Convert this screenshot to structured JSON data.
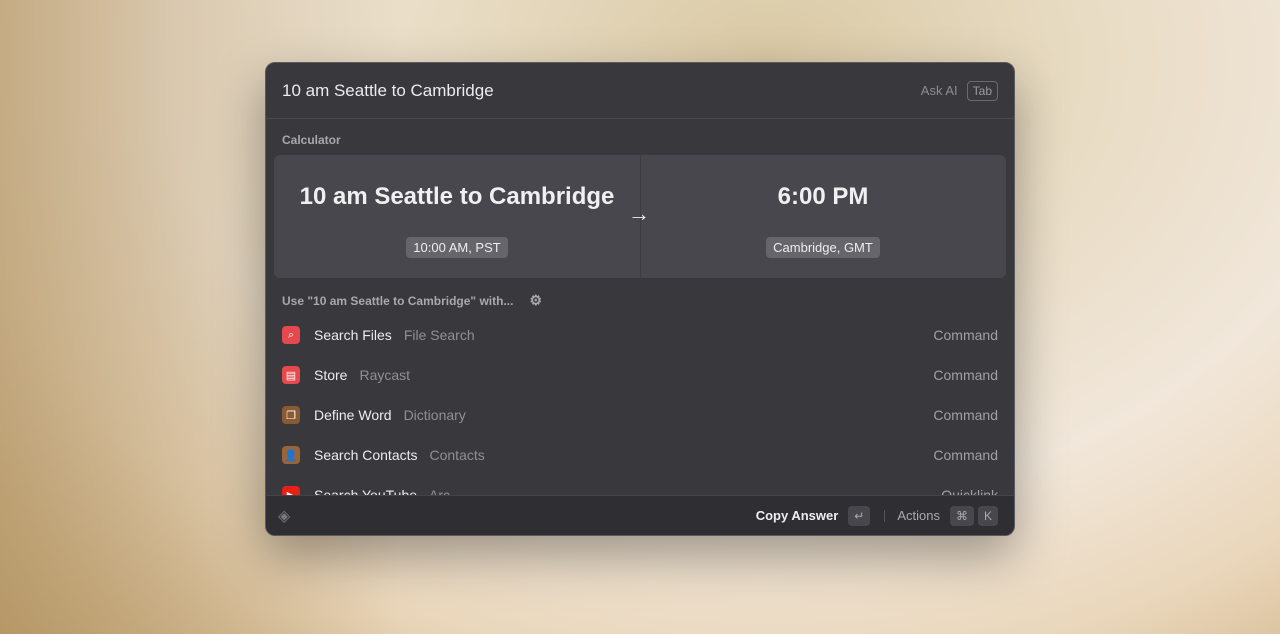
{
  "search": {
    "query": "10 am Seattle to Cambridge",
    "ask_ai": "Ask AI",
    "tab_key": "Tab"
  },
  "calculator": {
    "section": "Calculator",
    "input": "10 am Seattle to Cambridge",
    "input_detail": "10:00 AM, PST",
    "result": "6:00 PM",
    "result_detail": "Cambridge, GMT"
  },
  "use_with": "Use \"10 am Seattle to Cambridge\" with...",
  "items": [
    {
      "title": "Search Files",
      "subtitle": "File Search",
      "kind": "Command",
      "icon": "magnifier-icon",
      "color": "#e5484d"
    },
    {
      "title": "Store",
      "subtitle": "Raycast",
      "kind": "Command",
      "icon": "store-icon",
      "color": "#e5484d"
    },
    {
      "title": "Define Word",
      "subtitle": "Dictionary",
      "kind": "Command",
      "icon": "book-icon",
      "color": "#8a5a35"
    },
    {
      "title": "Search Contacts",
      "subtitle": "Contacts",
      "kind": "Command",
      "icon": "contact-icon",
      "color": "#9a6438"
    },
    {
      "title": "Search YouTube",
      "subtitle": "Arc",
      "kind": "Quicklink",
      "icon": "youtube-icon",
      "color": "#e62117"
    }
  ],
  "footer": {
    "primary": "Copy Answer",
    "enter_key": "↵",
    "actions": "Actions",
    "cmd_key": "⌘",
    "k_key": "K"
  }
}
